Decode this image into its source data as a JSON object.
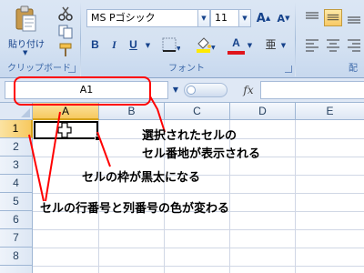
{
  "ribbon": {
    "clipboard": {
      "paste_label": "貼り付け",
      "caption": "クリップボード"
    },
    "font": {
      "font_name": "MS Pゴシック",
      "font_size": "11",
      "caption": "フォント",
      "grow_label": "A",
      "shrink_label": "A",
      "bold_label": "B",
      "italic_label": "I",
      "underline_label": "U",
      "font_color_label": "A",
      "phonetic_label": "亜"
    },
    "alignment": {
      "caption": "配"
    }
  },
  "formula_bar": {
    "name_box_value": "A1",
    "fx_label": "fx",
    "formula_value": ""
  },
  "sheet": {
    "columns": [
      "A",
      "B",
      "C",
      "D",
      "E"
    ],
    "rows": [
      "1",
      "2",
      "3",
      "4",
      "5",
      "6",
      "7",
      "8"
    ],
    "selected_cell": "A1"
  },
  "annotations": {
    "namebox_note_line1": "選択されたセルの",
    "namebox_note_line2": "セル番地が表示される",
    "border_note": "セルの枠が黒太になる",
    "headers_note": "セルの行番号と列番号の色が変わる"
  },
  "colors": {
    "annotation_line": "#ff0000",
    "selection_header": "#f7c95f",
    "active_border": "#000000"
  }
}
